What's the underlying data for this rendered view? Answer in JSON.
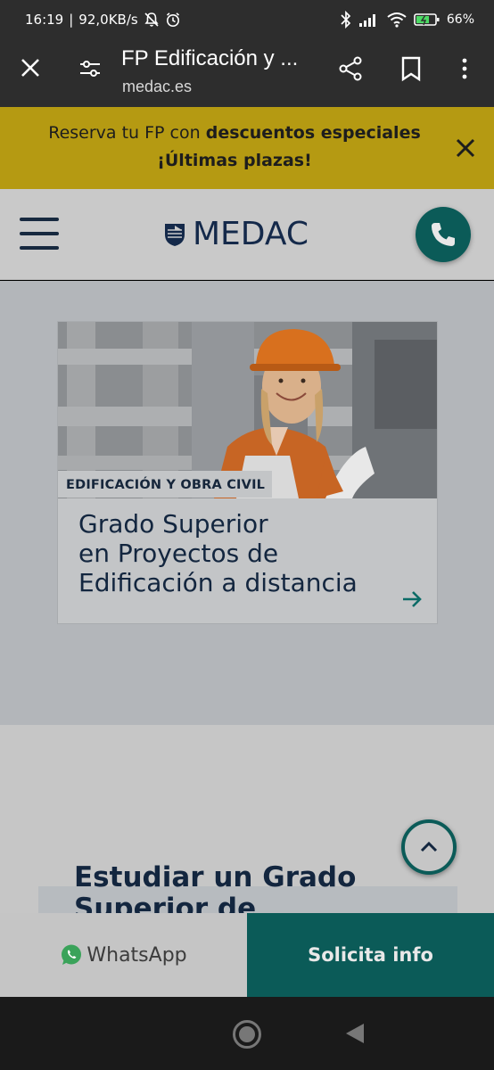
{
  "status_bar": {
    "time": "16:19",
    "separator": "|",
    "network_speed": "92,0KB/s",
    "battery": "66%",
    "icons": [
      "mute-icon",
      "alarm-icon",
      "bluetooth-icon",
      "signal-icon",
      "wifi-icon",
      "battery-icon"
    ]
  },
  "browser": {
    "title": "FP Edificación y ...",
    "url": "medac.es",
    "icons": [
      "close-icon",
      "tune-icon",
      "share-icon",
      "bookmark-icon",
      "more-icon"
    ]
  },
  "promo": {
    "text_prefix": "Reserva tu FP con ",
    "text_strong": "descuentos especiales",
    "line2": "¡Últimas plazas!",
    "background": "#b59a12"
  },
  "header": {
    "logo_text": "MEDAC",
    "icons": [
      "menu-icon",
      "phone-icon"
    ]
  },
  "card": {
    "tag": "EDIFICACIÓN Y OBRA CIVIL",
    "title_line1": "Grado Superior",
    "title_line2": "en Proyectos de",
    "title_line3": "Edificación a distancia"
  },
  "section2": {
    "title_line1": "Estudiar un Grado",
    "title_line2": "Superior de"
  },
  "cta": {
    "whatsapp_label": "WhatsApp",
    "info_label": "Solicita info",
    "accent": "#0b5b58"
  }
}
